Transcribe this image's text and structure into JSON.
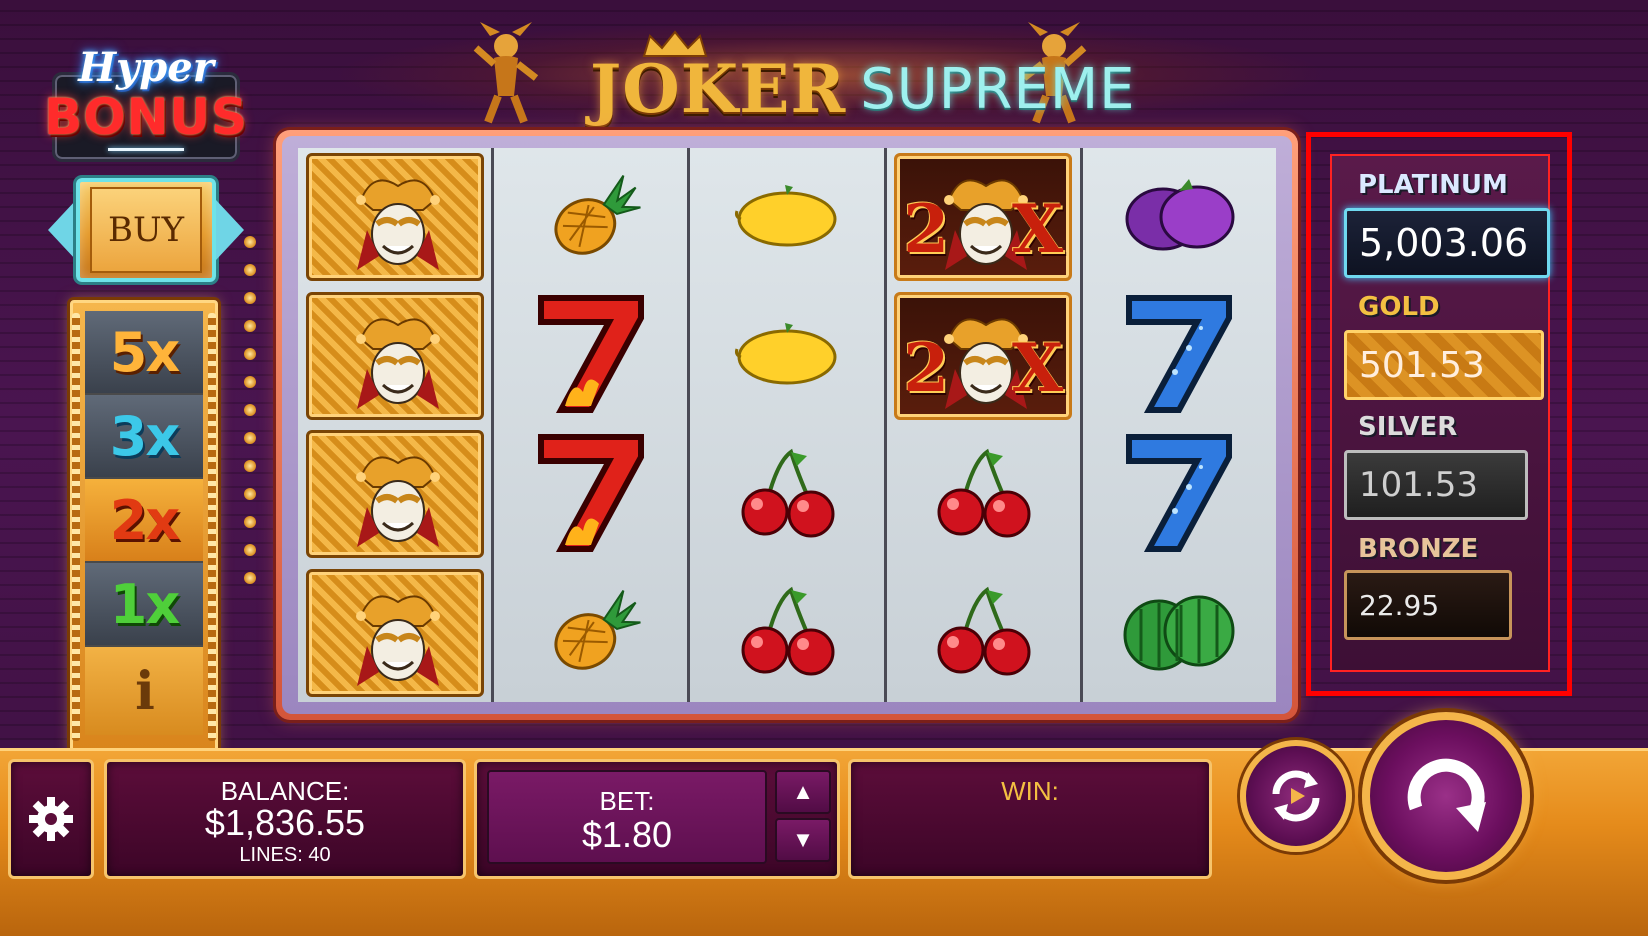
{
  "header": {
    "title_main": "JOKER",
    "title_sub": "SUPREME"
  },
  "hyper_bonus": {
    "line1": "Hyper",
    "line2": "BONUS",
    "buy_label": "BUY"
  },
  "multipliers": {
    "items": [
      "5x",
      "3x",
      "2x",
      "1x"
    ],
    "active": "2x",
    "info_label": "i"
  },
  "reels": [
    [
      "joker",
      "joker",
      "joker",
      "joker"
    ],
    [
      "pineapple",
      "seven-red",
      "seven-red",
      "pineapple"
    ],
    [
      "lemon",
      "lemon",
      "cherries",
      "cherries"
    ],
    [
      "joker-2x",
      "joker-2x",
      "cherries",
      "cherries"
    ],
    [
      "plum",
      "seven-blue",
      "seven-blue",
      "watermelon"
    ]
  ],
  "wild_multiplier_label": {
    "left": "2",
    "right": "X"
  },
  "jackpots": {
    "platinum": {
      "label": "PLATINUM",
      "value": "5,003.06"
    },
    "gold": {
      "label": "GOLD",
      "value": "501.53"
    },
    "silver": {
      "label": "SILVER",
      "value": "101.53"
    },
    "bronze": {
      "label": "BRONZE",
      "value": "22.95"
    }
  },
  "bottom_bar": {
    "balance_label": "BALANCE:",
    "balance_value": "$1,836.55",
    "lines_label": "LINES: 40",
    "bet_label": "BET:",
    "bet_value": "$1.80",
    "bet_up": "▲",
    "bet_down": "▼",
    "win_label": "WIN:",
    "win_value": ""
  },
  "colors": {
    "accent_gold": "#f4b54a",
    "panel_purple": "#5c0d3a",
    "highlight_red": "#ff0000"
  }
}
